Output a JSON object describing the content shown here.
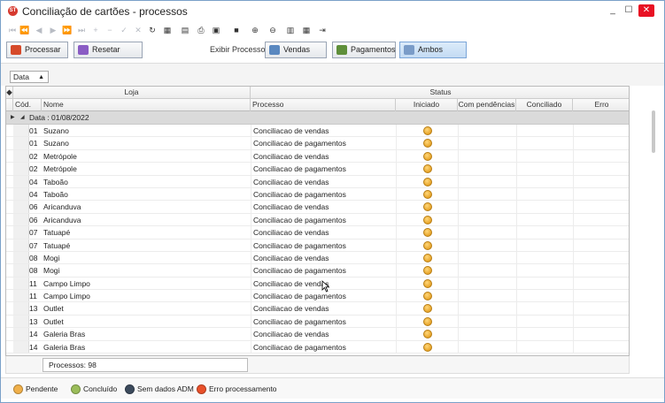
{
  "window": {
    "title": "Conciliação de cartões - processos",
    "app_icon": "app-icon",
    "minimize": "_",
    "maximize": "☐",
    "close": "✕"
  },
  "nav_toolbar": [
    {
      "name": "first-record-icon",
      "glyph": "⏮",
      "enabled": false
    },
    {
      "name": "prev-page-icon",
      "glyph": "⏪",
      "enabled": false
    },
    {
      "name": "prev-record-icon",
      "glyph": "◀",
      "enabled": false
    },
    {
      "name": "next-record-icon",
      "glyph": "▶",
      "enabled": false
    },
    {
      "name": "next-page-icon",
      "glyph": "⏩",
      "enabled": false
    },
    {
      "name": "last-record-icon",
      "glyph": "⏭",
      "enabled": false
    },
    {
      "name": "insert-icon",
      "glyph": "+",
      "enabled": false
    },
    {
      "name": "delete-icon",
      "glyph": "−",
      "enabled": false
    },
    {
      "name": "confirm-icon",
      "glyph": "✓",
      "enabled": false
    },
    {
      "name": "cancel-icon",
      "glyph": "✕",
      "enabled": false
    },
    {
      "name": "refresh-icon",
      "glyph": "↻",
      "enabled": true
    },
    {
      "name": "export-icon",
      "glyph": "▦",
      "enabled": true
    },
    {
      "name": "document-icon",
      "glyph": "▤",
      "enabled": true
    },
    {
      "name": "print-icon",
      "glyph": "⎙",
      "enabled": true
    },
    {
      "name": "print-preview-icon",
      "glyph": "▣",
      "enabled": true
    },
    {
      "name": "note-icon",
      "glyph": "■",
      "enabled": true
    },
    {
      "name": "zoom-in-icon",
      "glyph": "⊕",
      "enabled": true
    },
    {
      "name": "zoom-out-icon",
      "glyph": "⊖",
      "enabled": true
    },
    {
      "name": "report-icon",
      "glyph": "▥",
      "enabled": true
    },
    {
      "name": "calendar-icon",
      "glyph": "▦",
      "enabled": true
    },
    {
      "name": "exit-icon",
      "glyph": "⇥",
      "enabled": true
    }
  ],
  "actions": {
    "processar": "Processar",
    "resetar": "Resetar",
    "exibir_label": "Exibir Processo:",
    "vendas": "Vendas",
    "pagamentos": "Pagamentos",
    "ambos": "Ambos"
  },
  "group_by": "Data",
  "grid": {
    "band_loja": "Loja",
    "band_status": "Status",
    "columns": [
      "Cód.",
      "Nome",
      "Processo",
      "Iniciado",
      "Com pendências",
      "Conciliado",
      "Erro"
    ],
    "group_label": "Data  : 01/08/2022",
    "rows": [
      {
        "cod": "01",
        "nome": "Suzano",
        "processo": "Conciliacao de vendas"
      },
      {
        "cod": "01",
        "nome": "Suzano",
        "processo": "Conciliacao de pagamentos"
      },
      {
        "cod": "02",
        "nome": "Metrópole",
        "processo": "Conciliacao de vendas"
      },
      {
        "cod": "02",
        "nome": "Metrópole",
        "processo": "Conciliacao de pagamentos"
      },
      {
        "cod": "04",
        "nome": "Taboão",
        "processo": "Conciliacao de vendas"
      },
      {
        "cod": "04",
        "nome": "Taboão",
        "processo": "Conciliacao de pagamentos"
      },
      {
        "cod": "06",
        "nome": "Aricanduva",
        "processo": "Conciliacao de vendas"
      },
      {
        "cod": "06",
        "nome": "Aricanduva",
        "processo": "Conciliacao de pagamentos"
      },
      {
        "cod": "07",
        "nome": "Tatuapé",
        "processo": "Conciliacao de vendas"
      },
      {
        "cod": "07",
        "nome": "Tatuapé",
        "processo": "Conciliacao de pagamentos"
      },
      {
        "cod": "08",
        "nome": "Mogi",
        "processo": "Conciliacao de vendas"
      },
      {
        "cod": "08",
        "nome": "Mogi",
        "processo": "Conciliacao de pagamentos"
      },
      {
        "cod": "11",
        "nome": "Campo Limpo",
        "processo": "Conciliacao de vendas"
      },
      {
        "cod": "11",
        "nome": "Campo Limpo",
        "processo": "Conciliacao de pagamentos"
      },
      {
        "cod": "13",
        "nome": "Outlet",
        "processo": "Conciliacao de vendas"
      },
      {
        "cod": "13",
        "nome": "Outlet",
        "processo": "Conciliacao de pagamentos"
      },
      {
        "cod": "14",
        "nome": "Galeria Bras",
        "processo": "Conciliacao de vendas"
      },
      {
        "cod": "14",
        "nome": "Galeria Bras",
        "processo": "Conciliacao de pagamentos"
      }
    ],
    "summary": "Processos: 98"
  },
  "legend": [
    {
      "label": "Pendente",
      "color": "#f0b04a"
    },
    {
      "label": "Concluído",
      "color": "#9bbd5a"
    },
    {
      "label": "Sem dados ADM",
      "color": "#3b4a5c"
    },
    {
      "label": "Erro processamento",
      "color": "#e8502a"
    }
  ]
}
